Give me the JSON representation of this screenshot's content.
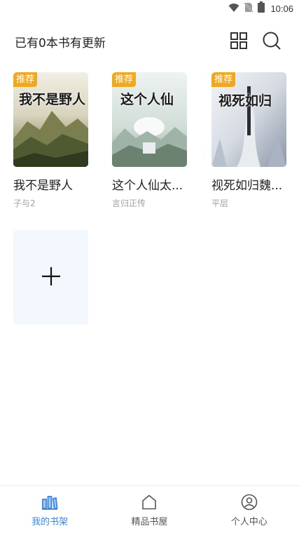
{
  "status_bar": {
    "time": "10:06",
    "icons": [
      "wifi-icon",
      "no-sim-icon",
      "battery-icon"
    ]
  },
  "header": {
    "title": "已有0本书有更新",
    "icons": [
      "grid-view-icon",
      "search-icon"
    ]
  },
  "books": [
    {
      "title": "我不是野人",
      "author": "子与2",
      "badge": "推荐",
      "cover_text": "我不是野人"
    },
    {
      "title": "这个人仙太...",
      "author": "言归正传",
      "badge": "推荐",
      "cover_text": "这个人仙"
    },
    {
      "title": "视死如归魏...",
      "author": "平层",
      "badge": "推荐",
      "cover_text": "视死如归"
    }
  ],
  "add_button": {
    "icon": "plus-icon"
  },
  "bottom_nav": {
    "items": [
      {
        "label": "我的书架",
        "icon": "bookshelf-icon",
        "active": true
      },
      {
        "label": "精品书屋",
        "icon": "house-icon",
        "active": false
      },
      {
        "label": "个人中心",
        "icon": "user-icon",
        "active": false
      }
    ]
  },
  "colors": {
    "accent": "#3a86dd",
    "badge": "#f0a91f",
    "add_card_bg": "#f3f8fe"
  }
}
